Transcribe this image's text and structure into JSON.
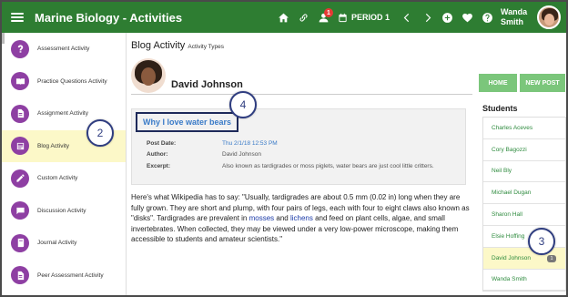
{
  "header": {
    "app_title": "Marine Biology - Activities",
    "notification_count": "1",
    "period_label": "PERIOD 1",
    "user_first": "Wanda",
    "user_last": "Smith"
  },
  "sidebar": {
    "items": [
      {
        "label": "Assessment Activity",
        "icon": "question-icon"
      },
      {
        "label": "Practice Questions Activity",
        "icon": "book-open-icon"
      },
      {
        "label": "Assignment Activity",
        "icon": "document-icon"
      },
      {
        "label": "Blog Activity",
        "icon": "blog-icon",
        "active": true
      },
      {
        "label": "Custom Activity",
        "icon": "pencil-icon"
      },
      {
        "label": "Discussion Activity",
        "icon": "chat-icon"
      },
      {
        "label": "Journal Activity",
        "icon": "journal-icon"
      },
      {
        "label": "Peer Assessment Activity",
        "icon": "document-icon"
      }
    ]
  },
  "main": {
    "page_title": "Blog Activity",
    "page_subtitle": "Activity Types",
    "student_name": "David Johnson",
    "post": {
      "title": "Why I love water bears",
      "post_date_label": "Post Date:",
      "post_date_value": "Thu 2/1/18 12:53 PM",
      "author_label": "Author:",
      "author_value": "David Johnson",
      "excerpt_label": "Excerpt:",
      "excerpt_value": "Also known as tardigrades or moss piglets, water bears are just cool little critters."
    },
    "body_text_1": "Here's what Wikipedia has to say: \"Usually, tardigrades are about 0.5 mm (0.02 in) long when they are fully grown. They are short and plump, with four pairs of legs, each with four to eight claws also known as \"disks\". Tardigrades are prevalent in ",
    "body_link_1": "mosses",
    "body_text_2": " and ",
    "body_link_2": "lichens",
    "body_text_3": " and feed on plant cells, algae, and small invertebrates. When collected, they may be viewed under a very low-power microscope, making them accessible to students and amateur scientists.\""
  },
  "right": {
    "home_label": "HOME",
    "new_post_label": "NEW POST",
    "students_heading": "Students",
    "students": [
      {
        "name": "Charles Aceves"
      },
      {
        "name": "Cory Bagozzi"
      },
      {
        "name": "Neil Bly"
      },
      {
        "name": "Michael Dugan"
      },
      {
        "name": "Sharon Hall"
      },
      {
        "name": "Elsie Hoffing"
      },
      {
        "name": "David Johnson",
        "badge": "1",
        "active": true
      },
      {
        "name": "Wanda Smith"
      }
    ]
  },
  "callouts": [
    "2",
    "3",
    "4"
  ],
  "colors": {
    "brand_green": "#2e7d32",
    "accent_purple": "#8e3fa3",
    "link_blue": "#3a7bc8",
    "highlight_yellow": "#fcf8c8",
    "button_green": "#7bc67b"
  }
}
